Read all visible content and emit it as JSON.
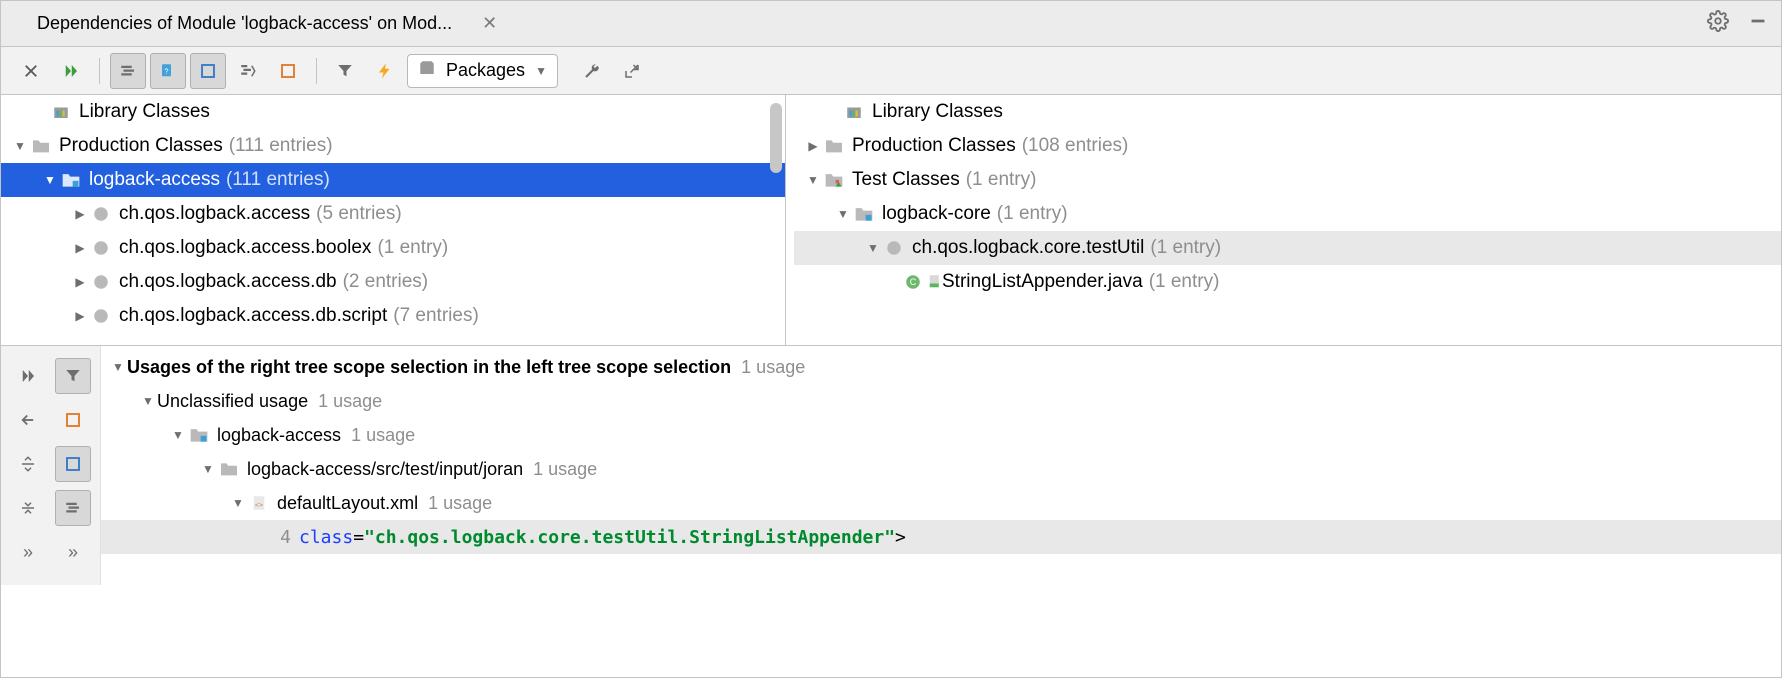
{
  "tab": {
    "title": "Dependencies of Module 'logback-access' on Mod..."
  },
  "toolbar": {
    "dropdown_label": "Packages"
  },
  "leftTree": {
    "rows": [
      {
        "arrow": "none",
        "indent": 24,
        "iconType": "lib",
        "label": "Library Classes",
        "count": ""
      },
      {
        "arrow": "open",
        "indent": 4,
        "iconType": "folder",
        "label": "Production Classes",
        "count": "(111 entries)"
      },
      {
        "arrow": "open",
        "indent": 34,
        "iconType": "module",
        "label": "logback-access",
        "count": "(111 entries)",
        "selected": true
      },
      {
        "arrow": "closed",
        "indent": 64,
        "iconType": "package",
        "label": "ch.qos.logback.access",
        "count": "(5 entries)"
      },
      {
        "arrow": "closed",
        "indent": 64,
        "iconType": "package",
        "label": "ch.qos.logback.access.boolex",
        "count": "(1 entry)"
      },
      {
        "arrow": "closed",
        "indent": 64,
        "iconType": "package",
        "label": "ch.qos.logback.access.db",
        "count": "(2 entries)"
      },
      {
        "arrow": "closed",
        "indent": 64,
        "iconType": "package",
        "label": "ch.qos.logback.access.db.script",
        "count": "(7 entries)"
      }
    ]
  },
  "rightTree": {
    "rows": [
      {
        "arrow": "none",
        "indent": 24,
        "iconType": "lib",
        "label": "Library Classes",
        "count": ""
      },
      {
        "arrow": "closed",
        "indent": 4,
        "iconType": "folder",
        "label": "Production Classes",
        "count": "(108 entries)"
      },
      {
        "arrow": "open",
        "indent": 4,
        "iconType": "test",
        "label": "Test Classes",
        "count": "(1 entry)"
      },
      {
        "arrow": "open",
        "indent": 34,
        "iconType": "module",
        "label": "logback-core",
        "count": "(1 entry)"
      },
      {
        "arrow": "open",
        "indent": 64,
        "iconType": "package",
        "label": "ch.qos.logback.core.testUtil",
        "count": "(1 entry)",
        "shaded": true
      },
      {
        "arrow": "none",
        "indent": 94,
        "iconType": "classfile",
        "label": "StringListAppender.java",
        "count": "(1 entry)"
      }
    ]
  },
  "usages": {
    "title": "Usages of the right tree scope selection in the left tree scope selection",
    "title_count": "1 usage",
    "rows": [
      {
        "indent": 30,
        "label": "Unclassified usage",
        "count": "1 usage",
        "icon": "none"
      },
      {
        "indent": 60,
        "label": "logback-access",
        "count": "1 usage",
        "icon": "module"
      },
      {
        "indent": 90,
        "label": "logback-access/src/test/input/joran",
        "count": "1 usage",
        "icon": "folder-plain"
      },
      {
        "indent": 120,
        "label": "defaultLayout.xml",
        "count": "1 usage",
        "icon": "xml"
      }
    ],
    "code": {
      "indent": 180,
      "lineno": "4",
      "attr": "class",
      "eq": "=",
      "val": "\"ch.qos.logback.core.testUtil.StringListAppender\"",
      "tail": ">"
    }
  }
}
